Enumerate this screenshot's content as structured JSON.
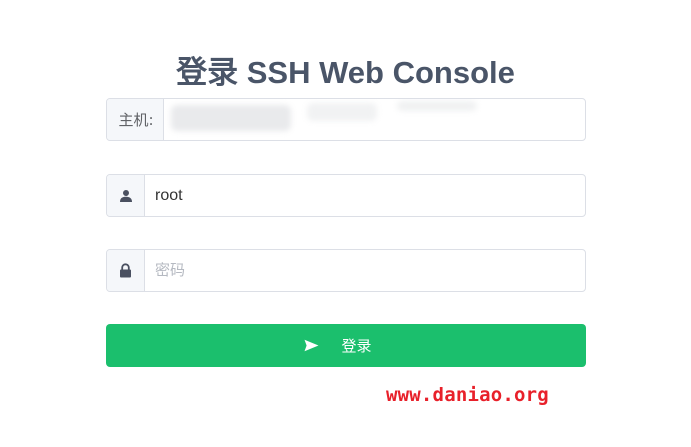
{
  "title": "登录 SSH Web Console",
  "form": {
    "host_label": "主机:",
    "host_value": "",
    "user_icon": "user-icon",
    "username_value": "root",
    "lock_icon": "lock-icon",
    "password_placeholder": "密码",
    "submit_icon": "send-icon",
    "submit_label": "登录"
  },
  "colors": {
    "title": "#4a5568",
    "button": "#1bbf6d",
    "watermark": "#e8202a"
  },
  "watermark": "www.daniao.org"
}
